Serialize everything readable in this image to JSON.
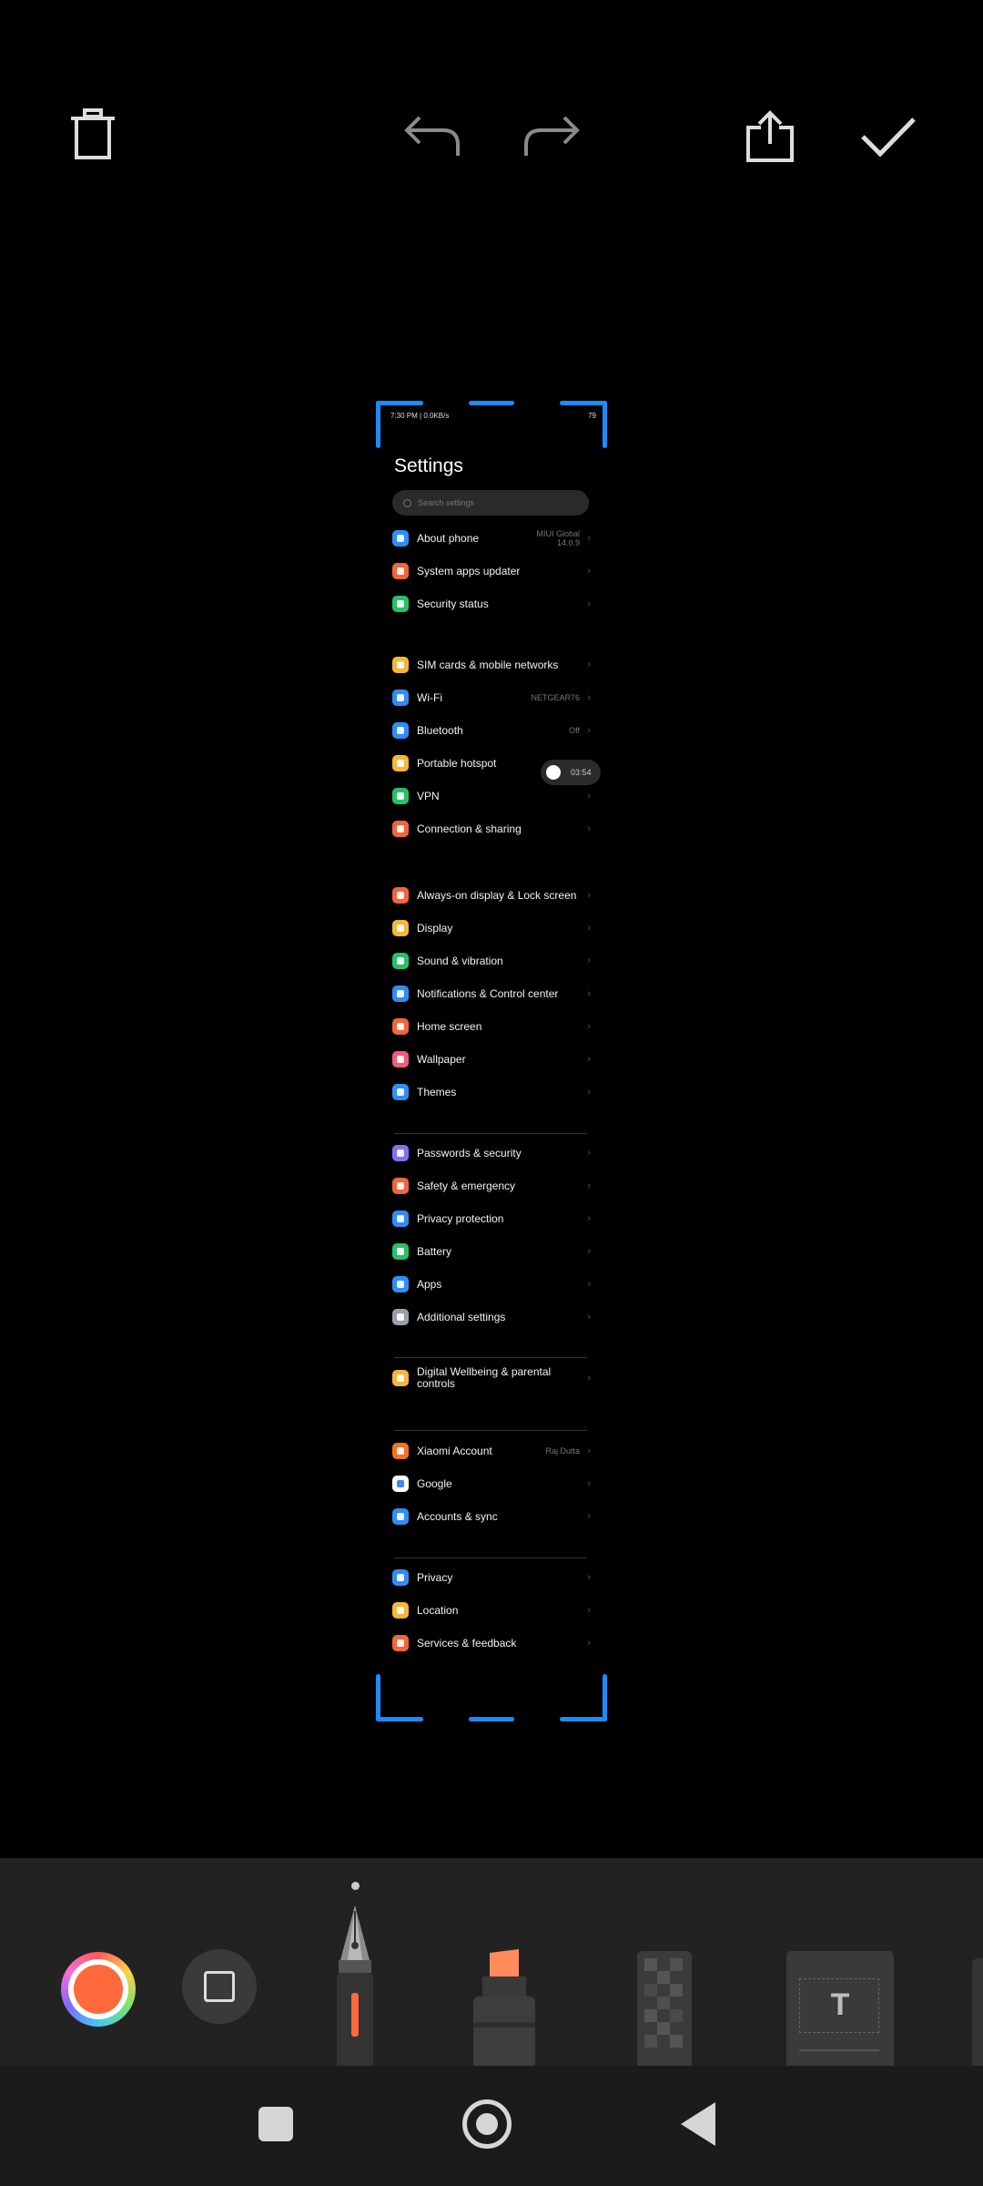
{
  "toolbar": {
    "delete_icon": "trash-icon",
    "undo_icon": "undo-arrow-icon",
    "redo_icon": "redo-arrow-icon",
    "share_icon": "share-icon",
    "done_icon": "checkmark-icon"
  },
  "accent_color": "#1a8cff",
  "screenshot": {
    "status_bar": {
      "left": "7:30 PM | 0.0KB/s",
      "right": "79"
    },
    "title": "Settings",
    "search_placeholder": "Search settings",
    "items": [
      {
        "label": "About phone",
        "value": "MIUI Global 14.0.9",
        "icon_color": "#2f8ef5"
      },
      {
        "label": "System apps updater",
        "value": "",
        "icon_color": "#f2653a"
      },
      {
        "label": "Security status",
        "value": "",
        "icon_color": "#27c06a"
      },
      {
        "label": "SIM cards & mobile networks",
        "value": "",
        "icon_color": "#f5b73a"
      },
      {
        "label": "Wi-Fi",
        "value": "NETGEAR76",
        "icon_color": "#2f8ef5"
      },
      {
        "label": "Bluetooth",
        "value": "Off",
        "icon_color": "#2f8ef5"
      },
      {
        "label": "Portable hotspot",
        "value": "",
        "icon_color": "#f5b73a"
      },
      {
        "label": "VPN",
        "value": "",
        "icon_color": "#27c06a"
      },
      {
        "label": "Connection & sharing",
        "value": "",
        "icon_color": "#f2653a"
      },
      {
        "label": "Always-on display & Lock screen",
        "value": "",
        "icon_color": "#f2653a"
      },
      {
        "label": "Display",
        "value": "",
        "icon_color": "#f5b73a"
      },
      {
        "label": "Sound & vibration",
        "value": "",
        "icon_color": "#27c06a"
      },
      {
        "label": "Notifications & Control center",
        "value": "",
        "icon_color": "#2f8ef5"
      },
      {
        "label": "Home screen",
        "value": "",
        "icon_color": "#f2653a"
      },
      {
        "label": "Wallpaper",
        "value": "",
        "icon_color": "#f25a7a"
      },
      {
        "label": "Themes",
        "value": "",
        "icon_color": "#2f8ef5"
      },
      {
        "label": "Passwords & security",
        "value": "",
        "icon_color": "#8a6cf5"
      },
      {
        "label": "Safety & emergency",
        "value": "",
        "icon_color": "#f2653a"
      },
      {
        "label": "Privacy protection",
        "value": "",
        "icon_color": "#2f8ef5"
      },
      {
        "label": "Battery",
        "value": "",
        "icon_color": "#27c06a"
      },
      {
        "label": "Apps",
        "value": "",
        "icon_color": "#2f8ef5"
      },
      {
        "label": "Additional settings",
        "value": "",
        "icon_color": "#9aa0a8"
      },
      {
        "label": "Digital Wellbeing & parental controls",
        "value": "",
        "icon_color": "#f5b73a"
      },
      {
        "label": "Xiaomi Account",
        "value": "Raj Dutta",
        "icon_color": "#f5731f"
      },
      {
        "label": "Google",
        "value": "",
        "icon_color": "#ffffff"
      },
      {
        "label": "Accounts & sync",
        "value": "",
        "icon_color": "#2f8ef5"
      },
      {
        "label": "Privacy",
        "value": "",
        "icon_color": "#2f8ef5"
      },
      {
        "label": "Location",
        "value": "",
        "icon_color": "#f5b73a"
      },
      {
        "label": "Services & feedback",
        "value": "",
        "icon_color": "#f2653a"
      }
    ],
    "hotspot_toggle_text": "03:54"
  },
  "tools": {
    "current_color": "#ff6a3d",
    "shape_icon": "square-shape-icon",
    "items": [
      "pen-tool",
      "highlighter-tool",
      "mosaic-tool",
      "text-tool"
    ],
    "text_tool_glyph": "T"
  },
  "nav": {
    "recents_icon": "square-icon",
    "home_icon": "circle-icon",
    "back_icon": "triangle-back-icon"
  }
}
